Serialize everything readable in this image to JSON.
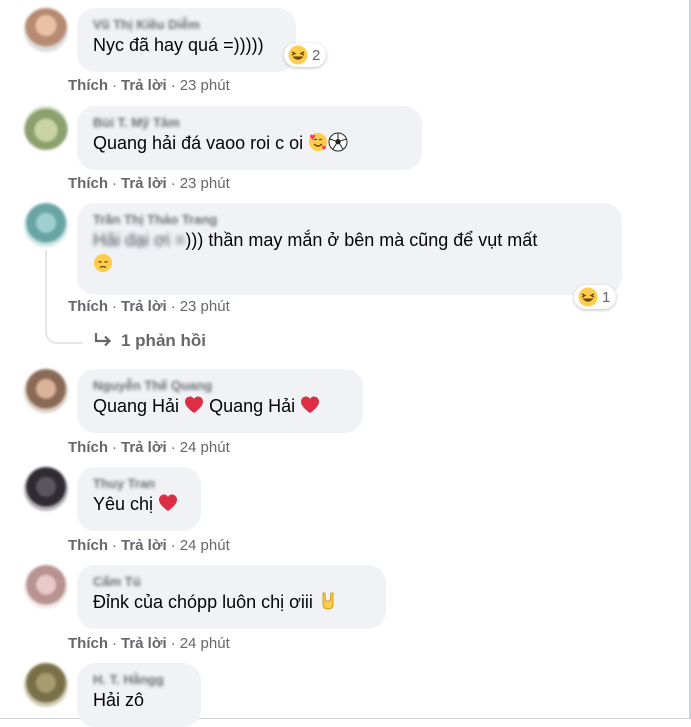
{
  "comments": [
    {
      "author": "Vũ Thị Kiều Diễm",
      "text": "Nyc đã hay quá =)))))",
      "reaction": {
        "icon": "laughing-emoji",
        "count": "2"
      },
      "like": "Thích",
      "reply": "Trả lời",
      "time": "23 phút"
    },
    {
      "author": "Bùi T. Mỹ Tâm",
      "text": "Quang hải đá vaoo roi c oi",
      "icons": [
        "smiling-hearts-emoji",
        "soccer-ball-emoji"
      ],
      "like": "Thích",
      "reply": "Trả lời",
      "time": "23 phút"
    },
    {
      "author": "Trần Thị Thảo Trang",
      "mention": "Hải dại ơi =",
      "text": "))) thần may mắn ở bên mà cũng để vụt mất",
      "icons": [
        "disappointed-emoji"
      ],
      "reaction": {
        "icon": "laughing-emoji",
        "count": "1"
      },
      "like": "Thích",
      "reply": "Trả lời",
      "time": "23 phút",
      "replies_label": "1 phản hồi"
    },
    {
      "author": "Nguyễn Thế Quang",
      "text_a": "Quang Hải",
      "text_b": "Quang Hải",
      "icons": [
        "red-heart-emoji",
        "red-heart-emoji"
      ],
      "like": "Thích",
      "reply": "Trả lời",
      "time": "24 phút"
    },
    {
      "author": "Thuy Tran",
      "text": "Yêu chị",
      "icons": [
        "red-heart-emoji"
      ],
      "like": "Thích",
      "reply": "Trả lời",
      "time": "24 phút"
    },
    {
      "author": "Cẩm Tú",
      "text": "Đỉnk của chópp luôn chị ơiii",
      "icons": [
        "rock-on-hand-emoji"
      ],
      "like": "Thích",
      "reply": "Trả lời",
      "time": "24 phút"
    },
    {
      "author": "H. T. Hằngg",
      "text": "Hải zô"
    }
  ],
  "colors": {
    "bubble": "#f0f2f5",
    "meta": "#65676b",
    "heart": "#f33e58",
    "emoji_yellow": "#ffcc4d"
  }
}
